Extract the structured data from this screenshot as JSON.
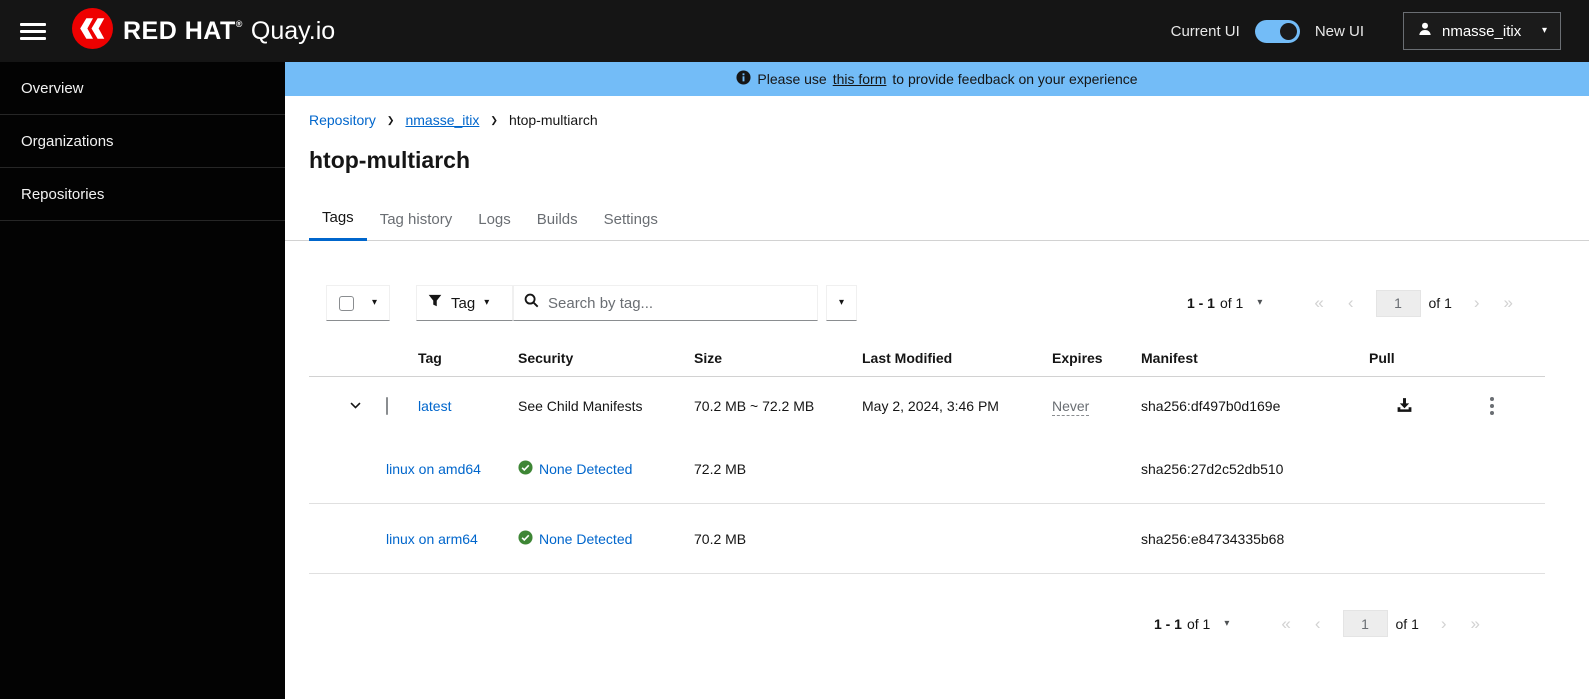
{
  "header": {
    "brand_red_hat": "RED HAT",
    "registered_mark": "®",
    "brand_product": "Quay.io",
    "toggle_left_label": "Current UI",
    "toggle_right_label": "New UI",
    "username": "nmasse_itix"
  },
  "sidebar": {
    "items": [
      {
        "label": "Overview"
      },
      {
        "label": "Organizations"
      },
      {
        "label": "Repositories"
      }
    ]
  },
  "banner": {
    "text_before": "Please use",
    "link_text": "this form",
    "text_after": "to provide feedback on your experience"
  },
  "breadcrumb": {
    "repository": "Repository",
    "namespace": "nmasse_itix",
    "current": "htop-multiarch"
  },
  "page": {
    "title": "htop-multiarch"
  },
  "tabs": [
    {
      "label": "Tags"
    },
    {
      "label": "Tag history"
    },
    {
      "label": "Logs"
    },
    {
      "label": "Builds"
    },
    {
      "label": "Settings"
    }
  ],
  "toolbar": {
    "filter_label": "Tag",
    "search_placeholder": "Search by tag..."
  },
  "pagination_top": {
    "range_strong": "1 - 1",
    "range_rest": "of 1",
    "page_value": "1",
    "of_pages": "of 1"
  },
  "pagination_bottom": {
    "range_strong": "1 - 1",
    "range_rest": "of 1",
    "page_value": "1",
    "of_pages": "of 1"
  },
  "table": {
    "columns": [
      "Tag",
      "Security",
      "Size",
      "Last Modified",
      "Expires",
      "Manifest",
      "Pull"
    ],
    "rows": [
      {
        "tag": "latest",
        "security": "See Child Manifests",
        "size": "70.2 MB ~ 72.2 MB",
        "last_modified": "May 2, 2024, 3:46 PM",
        "expires": "Never",
        "manifest": "sha256:df497b0d169e"
      },
      {
        "tag": "linux on amd64",
        "security": "None Detected",
        "size": "72.2 MB",
        "manifest": "sha256:27d2c52db510"
      },
      {
        "tag": "linux on arm64",
        "security": "None Detected",
        "size": "70.2 MB",
        "manifest": "sha256:e84734335b68"
      }
    ]
  },
  "icons": {
    "caret_down": "▾",
    "breadcrumb_separator": "❯",
    "first_page": "«",
    "prev_page": "‹",
    "next_page": "›",
    "last_page": "»",
    "hamburger": "css-three-bars",
    "kebab": "css-three-dots",
    "redhat_logo": "svg-red-circle-fedora",
    "user": "svg-user-silhouette",
    "info": "svg-info-circle",
    "filter": "svg-funnel",
    "search": "svg-magnifier",
    "expand_row": "svg-angle-down",
    "download": "svg-download-tray",
    "security_pass": "svg-check-circle-green"
  },
  "colors": {
    "header_bg": "#151515",
    "sidebar_bg": "#030303",
    "banner_blue": "#73bcf7",
    "brand_red": "#ee0000",
    "link_blue": "#0066cc",
    "success_green": "#3e8635"
  }
}
